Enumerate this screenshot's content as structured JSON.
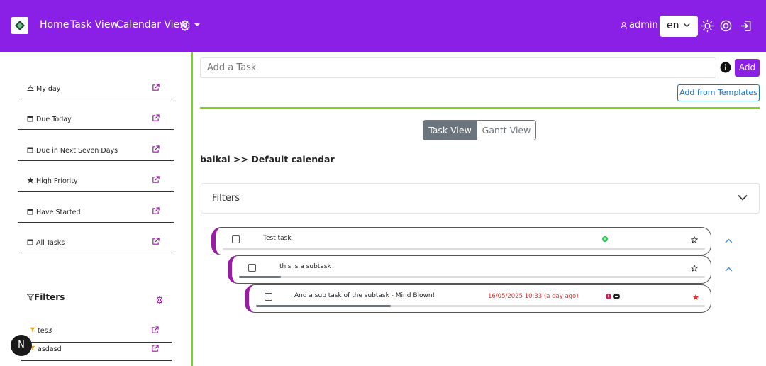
{
  "header": {
    "nav": [
      "Home",
      "Task View",
      "Calendar View"
    ],
    "username": "admin",
    "language": "en",
    "accent_color": "#8a1fe6"
  },
  "sidebar": {
    "items": [
      {
        "label": "My day",
        "icon": "sun-horizon-icon"
      },
      {
        "label": "Due Today",
        "icon": "calendar-icon"
      },
      {
        "label": "Due in Next Seven Days",
        "icon": "calendar-icon"
      },
      {
        "label": "High Priority",
        "icon": "star-icon"
      },
      {
        "label": "Have Started",
        "icon": "calendar-icon"
      },
      {
        "label": "All Tasks",
        "icon": "calendar-icon"
      }
    ],
    "filters_title": "Filters",
    "filters": [
      {
        "label": "tes3"
      },
      {
        "label": "asdasd"
      }
    ],
    "badge": "N"
  },
  "main": {
    "add_placeholder": "Add a Task",
    "add_label": "Add",
    "templates_label": "Add from Templates",
    "view_tabs": [
      "Task View",
      "Gantt View"
    ],
    "active_tab": "Task View",
    "breadcrumb": "baikal >> Default calendar",
    "filters_label": "Filters"
  },
  "tasks": [
    {
      "title": "Test task",
      "progress": 0,
      "starred": false,
      "due": ""
    },
    {
      "title": "this is a subtask",
      "progress": 0.09,
      "starred": false,
      "due": ""
    },
    {
      "title": "And a sub task of the subtask - Mind Blown!",
      "progress": 0.3,
      "starred": true,
      "due": "16/05/2025 10:33 (a day ago)"
    }
  ]
}
